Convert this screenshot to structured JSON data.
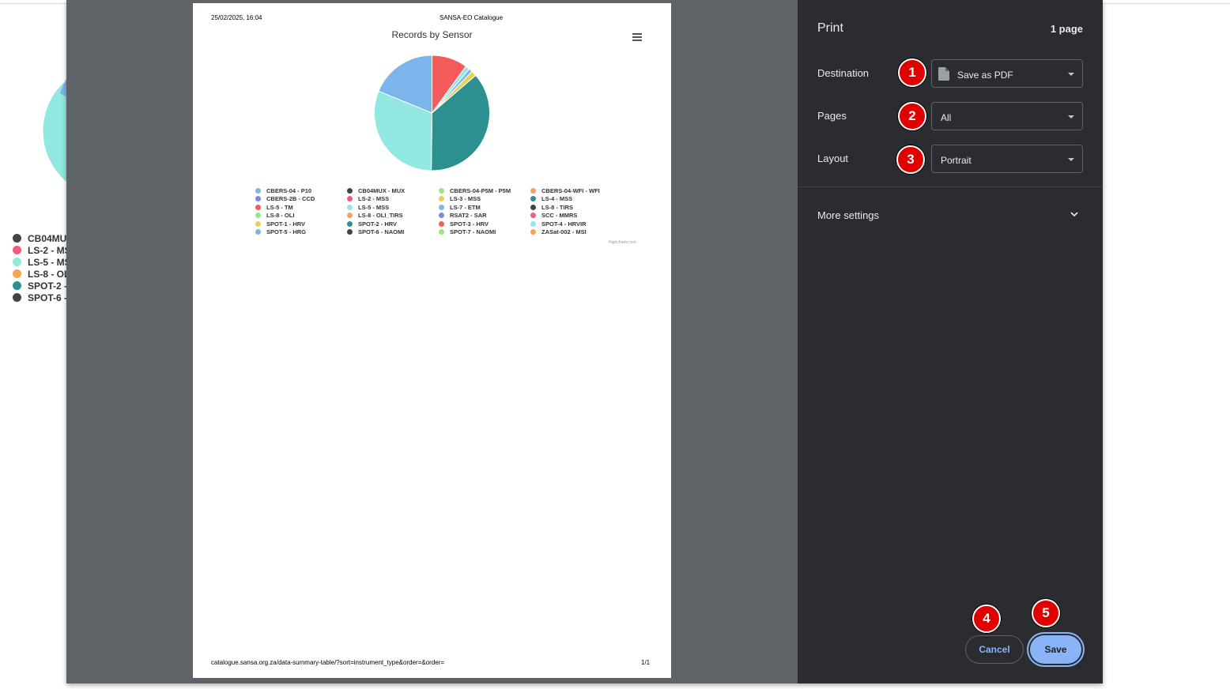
{
  "background_page": {
    "legend": [
      {
        "label": "CB04MU",
        "color": "#434348"
      },
      {
        "label": "LS-2 - MS",
        "color": "#f15c80"
      },
      {
        "label": "LS-5 - MS",
        "color": "#91e8e1"
      },
      {
        "label": "LS-8 - OL",
        "color": "#f7a35c"
      },
      {
        "label": "SPOT-2 -",
        "color": "#2b908f"
      },
      {
        "label": "SPOT-6 -",
        "color": "#434348"
      }
    ]
  },
  "preview": {
    "header_datetime": "25/02/2025, 16:04",
    "header_title": "SANSA-EO Catalogue",
    "footer_url": "catalogue.sansa.org.za/data-summary-table/?sort=instrument_type&order=&order=",
    "footer_page": "1/1",
    "credits": "Highcharts.com"
  },
  "chart_data": {
    "type": "pie",
    "title": "Records by Sensor",
    "slices": [
      {
        "name": "SCC - MMRS",
        "value": 10.0,
        "color": "#f45b5b"
      },
      {
        "name": "SPOT-4 - HRVIR",
        "value": 1.2,
        "color": "#91e8e1"
      },
      {
        "name": "LS-7 - ETM",
        "value": 1.0,
        "color": "#7cb5ec"
      },
      {
        "name": "SPOT-1 - HRV",
        "value": 1.5,
        "color": "#e4d354"
      },
      {
        "name": "SPOT-2 - HRV",
        "value": 36.5,
        "color": "#2b908f"
      },
      {
        "name": "LS-5 - MSS",
        "value": 31.0,
        "color": "#91e8e1"
      },
      {
        "name": "SPOT-5 - HRG",
        "value": 18.8,
        "color": "#7cb5ec"
      }
    ],
    "legend": [
      {
        "label": "CBERS-04 - P10",
        "color": "#7cb5ec"
      },
      {
        "label": "CB04MUX - MUX",
        "color": "#434348"
      },
      {
        "label": "CBERS-04-P5M - P5M",
        "color": "#90ed7d"
      },
      {
        "label": "CBERS-04-WFI - WFI",
        "color": "#f7a35c"
      },
      {
        "label": "CBERS-2B - CCD",
        "color": "#8085e9"
      },
      {
        "label": "LS-2 - MSS",
        "color": "#f15c80"
      },
      {
        "label": "LS-3 - MSS",
        "color": "#e4d354"
      },
      {
        "label": "LS-4 - MSS",
        "color": "#2b908f"
      },
      {
        "label": "LS-5 - TM",
        "color": "#f45b5b"
      },
      {
        "label": "LS-5 - MSS",
        "color": "#91e8e1"
      },
      {
        "label": "LS-7 - ETM",
        "color": "#7cb5ec"
      },
      {
        "label": "LS-8 - TIRS",
        "color": "#434348"
      },
      {
        "label": "LS-8 - OLI",
        "color": "#90ed7d"
      },
      {
        "label": "LS-8 - OLI_TIRS",
        "color": "#f7a35c"
      },
      {
        "label": "RSAT2 - SAR",
        "color": "#8085e9"
      },
      {
        "label": "SCC - MMRS",
        "color": "#f15c80"
      },
      {
        "label": "SPOT-1 - HRV",
        "color": "#e4d354"
      },
      {
        "label": "SPOT-2 - HRV",
        "color": "#2b908f"
      },
      {
        "label": "SPOT-3 - HRV",
        "color": "#f45b5b"
      },
      {
        "label": "SPOT-4 - HRVIR",
        "color": "#91e8e1"
      },
      {
        "label": "SPOT-5 - HRG",
        "color": "#7cb5ec"
      },
      {
        "label": "SPOT-6 - NAOMI",
        "color": "#434348"
      },
      {
        "label": "SPOT-7 - NAOMI",
        "color": "#90ed7d"
      },
      {
        "label": "ZASat-002 - MSI",
        "color": "#f7a35c"
      }
    ]
  },
  "settings": {
    "title": "Print",
    "page_count": "1 page",
    "destination_label": "Destination",
    "destination_value": "Save as PDF",
    "pages_label": "Pages",
    "pages_value": "All",
    "layout_label": "Layout",
    "layout_value": "Portrait",
    "more_settings_label": "More settings",
    "cancel_label": "Cancel",
    "save_label": "Save"
  },
  "badges": [
    "1",
    "2",
    "3",
    "4",
    "5"
  ]
}
